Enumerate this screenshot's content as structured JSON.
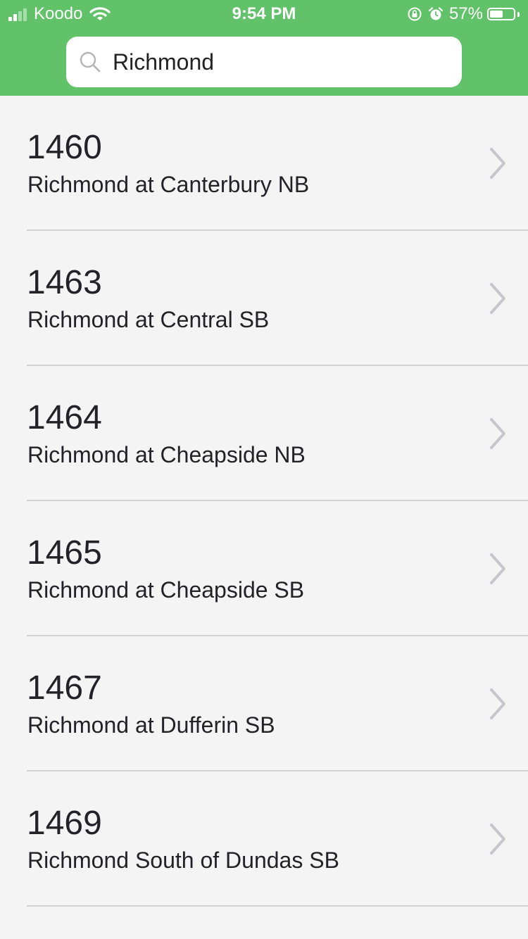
{
  "status_bar": {
    "carrier": "Koodo",
    "time": "9:54 PM",
    "battery_percent": "57%",
    "battery_level": 0.57,
    "signal_bars": 2,
    "icons": [
      "signal-icon",
      "wifi-icon",
      "orientation-lock-icon",
      "alarm-icon",
      "battery-icon"
    ]
  },
  "search": {
    "value": "Richmond",
    "icon": "search-icon"
  },
  "results": [
    {
      "stop_number": "1460",
      "stop_name": "Richmond at Canterbury NB"
    },
    {
      "stop_number": "1463",
      "stop_name": "Richmond at Central SB"
    },
    {
      "stop_number": "1464",
      "stop_name": "Richmond at Cheapside NB"
    },
    {
      "stop_number": "1465",
      "stop_name": "Richmond at Cheapside SB"
    },
    {
      "stop_number": "1467",
      "stop_name": "Richmond at Dufferin SB"
    },
    {
      "stop_number": "1469",
      "stop_name": "Richmond South of Dundas SB"
    }
  ],
  "colors": {
    "header": "#62c26a",
    "background": "#f4f4f4",
    "separator": "#d4d4d6",
    "chevron": "#c7c7cc"
  }
}
